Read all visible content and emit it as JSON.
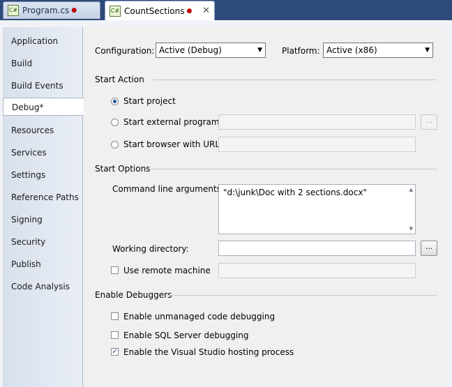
{
  "tabs": [
    {
      "label": "Program.cs",
      "icon": "csharp-file-icon"
    },
    {
      "label": "CountSections",
      "icon": "csharp-project-icon"
    }
  ],
  "sidebar": {
    "items": [
      {
        "label": "Application"
      },
      {
        "label": "Build"
      },
      {
        "label": "Build Events"
      },
      {
        "label": "Debug*"
      },
      {
        "label": "Resources"
      },
      {
        "label": "Services"
      },
      {
        "label": "Settings"
      },
      {
        "label": "Reference Paths"
      },
      {
        "label": "Signing"
      },
      {
        "label": "Security"
      },
      {
        "label": "Publish"
      },
      {
        "label": "Code Analysis"
      }
    ],
    "selected": "Debug*"
  },
  "config": {
    "configuration_label": "Configuration:",
    "configuration_value": "Active (Debug)",
    "platform_label": "Platform:",
    "platform_value": "Active (x86)"
  },
  "start_action": {
    "title": "Start Action",
    "start_project": "Start project",
    "start_external": "Start external program:",
    "start_browser": "Start browser with URL:",
    "browse_label": "..."
  },
  "start_options": {
    "title": "Start Options",
    "args_label": "Command line arguments:",
    "args_value": "\"d:\\junk\\Doc with 2 sections.docx\"",
    "workdir_label": "Working directory:",
    "workdir_value": "",
    "browse_label": "...",
    "remote_label": "Use remote machine"
  },
  "debuggers": {
    "title": "Enable Debuggers",
    "unmanaged": "Enable unmanaged code debugging",
    "sql": "Enable SQL Server debugging",
    "hosting": "Enable the Visual Studio hosting process",
    "checked_mark": "✓"
  },
  "colors": {
    "tabstrip": "#2e4a78",
    "accent": "#1d4f91",
    "dirty_marker": "#c00000"
  }
}
